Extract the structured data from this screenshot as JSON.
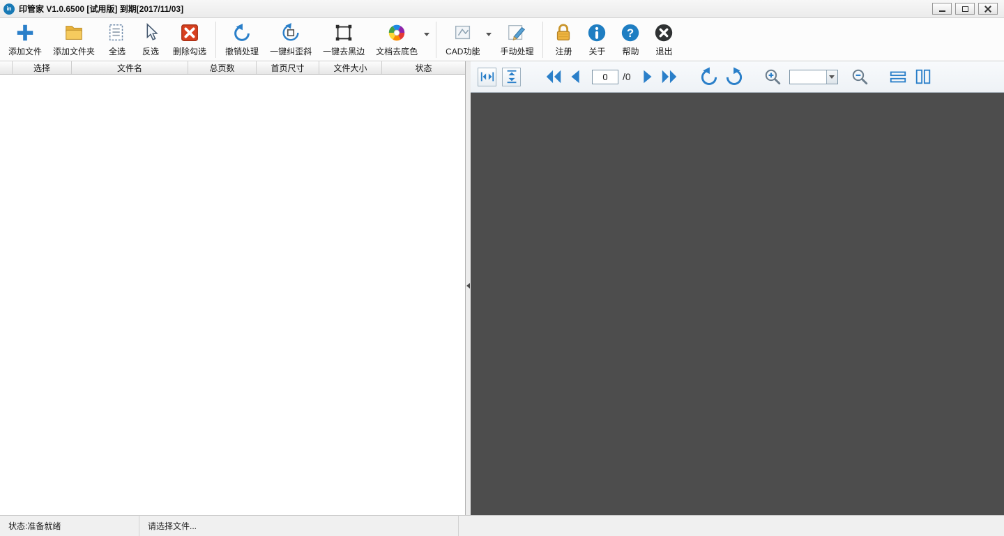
{
  "window": {
    "title": "印管家 V1.0.6500 [试用版] 到期[2017/11/03]",
    "app_icon_text": "in"
  },
  "toolbar": {
    "items": [
      {
        "label": "添加文件",
        "icon": "add-file-icon"
      },
      {
        "label": "添加文件夹",
        "icon": "add-folder-icon"
      },
      {
        "label": "全选",
        "icon": "select-all-icon"
      },
      {
        "label": "反选",
        "icon": "invert-selection-icon"
      },
      {
        "label": "删除勾选",
        "icon": "delete-checked-icon"
      },
      {
        "label": "撤销处理",
        "icon": "undo-icon"
      },
      {
        "label": "一键纠歪斜",
        "icon": "deskew-icon"
      },
      {
        "label": "一键去黑边",
        "icon": "remove-black-edge-icon"
      },
      {
        "label": "文档去底色",
        "icon": "remove-background-icon",
        "has_dropdown": true
      },
      {
        "label": "CAD功能",
        "icon": "cad-icon",
        "has_dropdown": true
      },
      {
        "label": "手动处理",
        "icon": "manual-edit-icon"
      },
      {
        "label": "注册",
        "icon": "register-lock-icon"
      },
      {
        "label": "关于",
        "icon": "about-icon"
      },
      {
        "label": "帮助",
        "icon": "help-icon"
      },
      {
        "label": "退出",
        "icon": "exit-icon"
      }
    ]
  },
  "file_table": {
    "columns": [
      "选择",
      "文件名",
      "总页数",
      "首页尺寸",
      "文件大小",
      "状态"
    ],
    "rows": []
  },
  "preview": {
    "page_number": "0",
    "page_total": "/0",
    "zoom_value": ""
  },
  "statusbar": {
    "status": "状态:准备就绪",
    "hint": "请选择文件..."
  },
  "colors": {
    "accent_blue": "#2a7fc9",
    "delete_red": "#d8401f",
    "folder_yellow": "#f2c04e",
    "lock_gold": "#eeb33f",
    "preview_bg": "#4d4d4d"
  }
}
